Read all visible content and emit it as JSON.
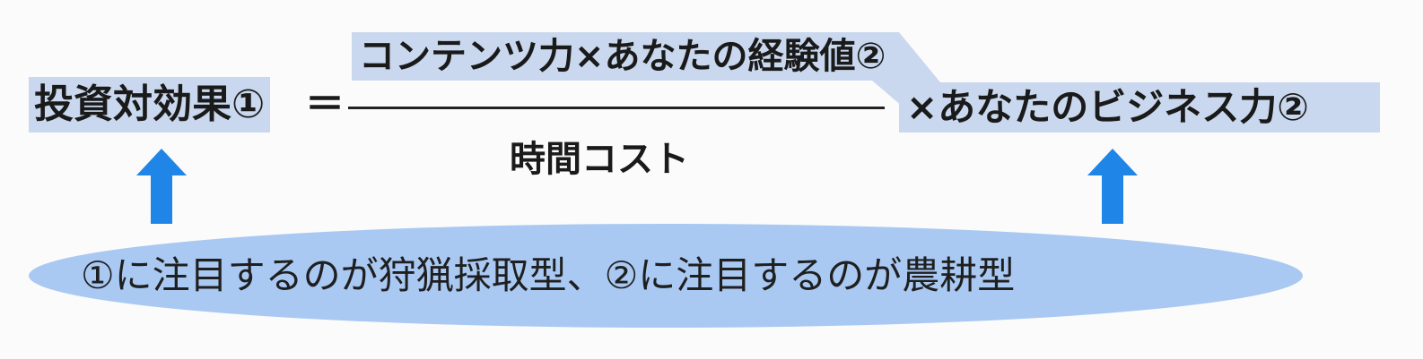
{
  "formula": {
    "left_term": "投資対効果①",
    "equals": "＝",
    "numerator": "コンテンツ力×あなたの経験値②",
    "denominator": "時間コスト",
    "right_term": "×あなたのビジネス力②"
  },
  "caption": "①に注目するのが狩猟採取型、②に注目するのが農耕型",
  "colors": {
    "highlight": "#c9d8ee",
    "arrow": "#1f86e8",
    "ellipse": "#a9c9f3"
  }
}
